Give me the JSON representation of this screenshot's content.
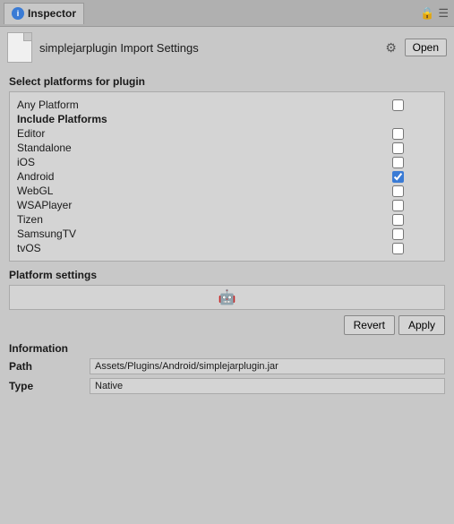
{
  "tab": {
    "label": "Inspector",
    "icon": "i"
  },
  "header": {
    "title": "simplejarplugin Import Settings",
    "open_button": "Open",
    "gear_icon": "⚙"
  },
  "platforms_section": {
    "title": "Select platforms for plugin",
    "any_platform_label": "Any Platform",
    "include_platforms_label": "Include Platforms",
    "platforms": [
      {
        "label": "Editor",
        "checked": false
      },
      {
        "label": "Standalone",
        "checked": false
      },
      {
        "label": "iOS",
        "checked": false
      },
      {
        "label": "Android",
        "checked": true
      },
      {
        "label": "WebGL",
        "checked": false
      },
      {
        "label": "WSAPlayer",
        "checked": false
      },
      {
        "label": "Tizen",
        "checked": false
      },
      {
        "label": "SamsungTV",
        "checked": false
      },
      {
        "label": "tvOS",
        "checked": false
      }
    ]
  },
  "platform_settings": {
    "label": "Platform settings",
    "android_icon": "🤖"
  },
  "buttons": {
    "revert": "Revert",
    "apply": "Apply"
  },
  "information": {
    "label": "Information",
    "path_label": "Path",
    "path_value": "Assets/Plugins/Android/simplejarplugin.jar",
    "type_label": "Type",
    "type_value": "Native"
  }
}
